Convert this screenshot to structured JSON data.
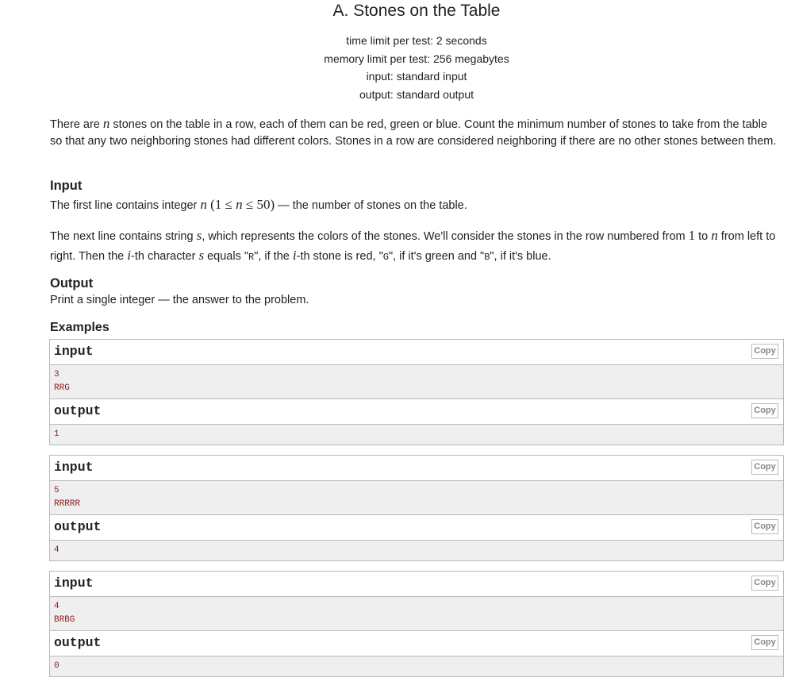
{
  "problem": {
    "title": "A. Stones on the Table",
    "time_limit": "time limit per test: 2 seconds",
    "memory_limit": "memory limit per test: 256 megabytes",
    "input_file": "input: standard input",
    "output_file": "output: standard output"
  },
  "statement": {
    "p1_a": "There are ",
    "p1_var_n": "n",
    "p1_b": " stones on the table in a row, each of them can be red, green or blue. Count the minimum number of stones to take from the table so that any two neighboring stones had different colors. Stones in a row are considered neighboring if there are no other stones between them."
  },
  "input_section": {
    "title": "Input",
    "line1_a": "The first line contains integer ",
    "line1_var": "n",
    "line1_range_open": "(1 ≤ ",
    "line1_range_var": "n",
    "line1_range_close": " ≤ 50)",
    "line1_b": " — the number of stones on the table.",
    "line2_a": "The next line contains string ",
    "line2_var_s": "s",
    "line2_b": ", which represents the colors of the stones. We'll consider the stones in the row numbered from ",
    "line2_one": "1",
    "line2_to": " to ",
    "line2_var_n": "n",
    "line2_c": " from left to right. Then the ",
    "line2_var_i": "i",
    "line2_d": "-th character ",
    "line2_var_s2": "s",
    "line2_e": " equals \"",
    "code_R": "R",
    "line2_f": "\", if the ",
    "line2_var_i2": "i",
    "line2_g": "-th stone is red, \"",
    "code_G": "G",
    "line2_h": "\", if it's green and \"",
    "code_B": "B",
    "line2_i": "\", if it's blue."
  },
  "output_section": {
    "title": "Output",
    "text": "Print a single integer — the answer to the problem."
  },
  "examples": {
    "title": "Examples",
    "input_label": "input",
    "output_label": "output",
    "copy_label": "Copy",
    "items": [
      {
        "input_lines": [
          "3",
          "RRG"
        ],
        "output": "1"
      },
      {
        "input_lines": [
          "5",
          "RRRRR"
        ],
        "output": "4"
      },
      {
        "input_lines": [
          "4",
          "BRBG"
        ],
        "output": "0"
      }
    ]
  }
}
